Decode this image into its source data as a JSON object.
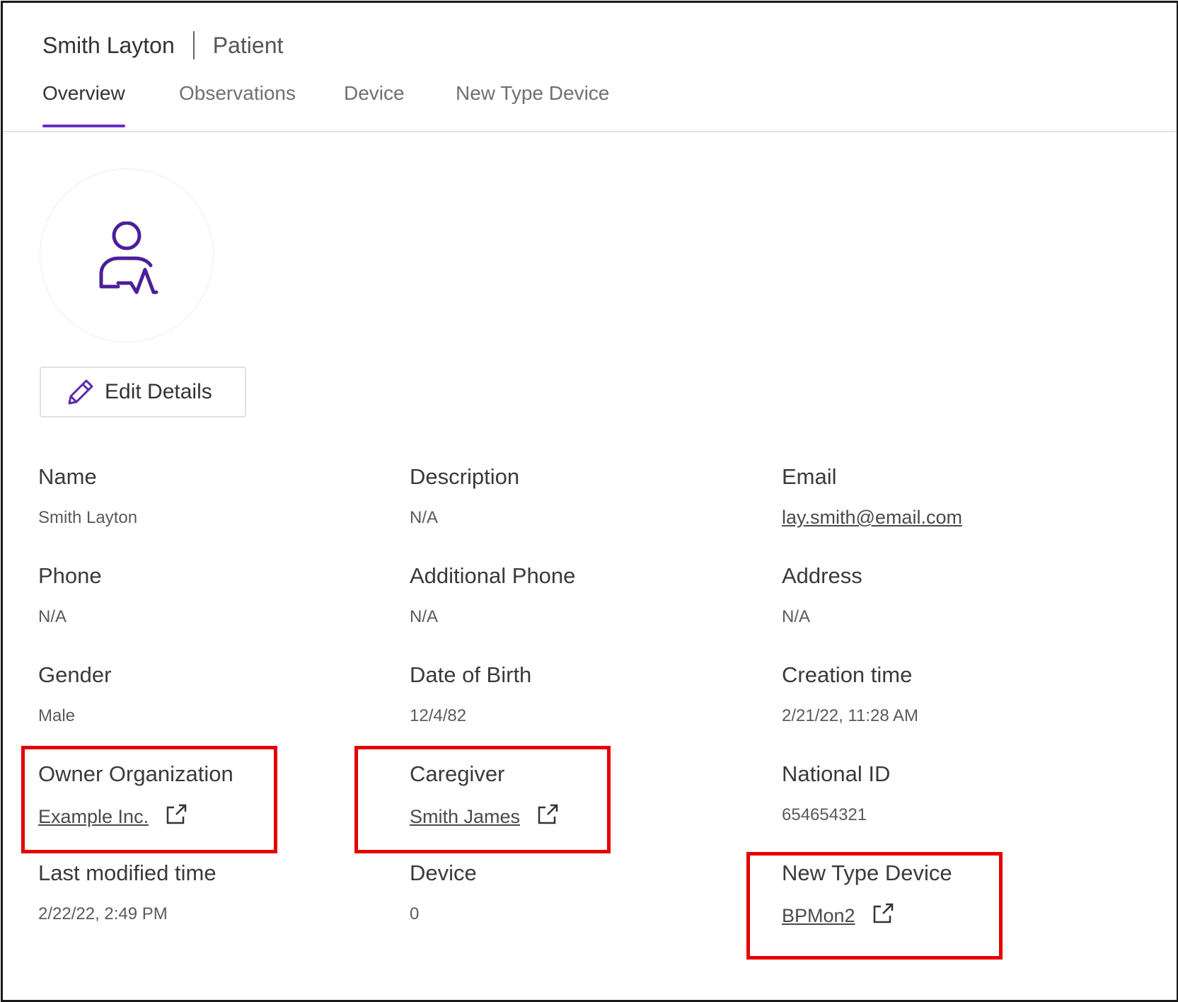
{
  "header": {
    "patient_name": "Smith Layton",
    "record_type": "Patient"
  },
  "tabs": [
    {
      "label": "Overview",
      "active": true
    },
    {
      "label": "Observations",
      "active": false
    },
    {
      "label": "Device",
      "active": false
    },
    {
      "label": "New Type Device",
      "active": false
    }
  ],
  "avatar": {
    "icon": "patient-icon"
  },
  "actions": {
    "edit_label": "Edit Details"
  },
  "fields": {
    "name": {
      "label": "Name",
      "value": "Smith Layton"
    },
    "description": {
      "label": "Description",
      "value": "N/A"
    },
    "email": {
      "label": "Email",
      "value": "lay.smith@email.com"
    },
    "phone": {
      "label": "Phone",
      "value": "N/A"
    },
    "additional_phone": {
      "label": "Additional Phone",
      "value": "N/A"
    },
    "address": {
      "label": "Address",
      "value": "N/A"
    },
    "gender": {
      "label": "Gender",
      "value": "Male"
    },
    "date_of_birth": {
      "label": "Date of Birth",
      "value": "12/4/82"
    },
    "creation_time": {
      "label": "Creation time",
      "value": "2/21/22, 11:28 AM"
    },
    "owner_organization": {
      "label": "Owner Organization",
      "value": "Example Inc."
    },
    "caregiver": {
      "label": "Caregiver",
      "value": "Smith James"
    },
    "national_id": {
      "label": "National ID",
      "value": "654654321"
    },
    "last_modified_time": {
      "label": "Last modified time",
      "value": "2/22/22, 2:49 PM"
    },
    "device": {
      "label": "Device",
      "value": "0"
    },
    "new_type_device": {
      "label": "New Type Device",
      "value": "BPMon2"
    }
  },
  "colors": {
    "accent": "#6b2cc9",
    "highlight": "#e50000"
  }
}
